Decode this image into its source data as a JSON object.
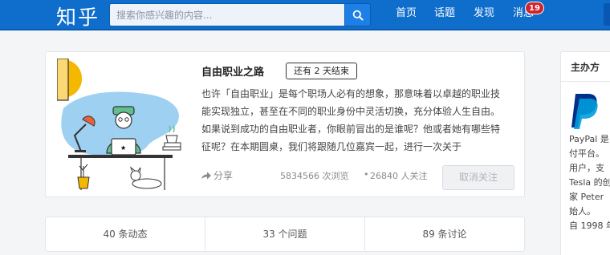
{
  "header": {
    "logo": "知乎",
    "search_placeholder": "搜索你感兴趣的内容...",
    "nav": {
      "home": "首页",
      "topics": "话题",
      "discover": "发现",
      "messages": "消息"
    },
    "message_count": "19"
  },
  "roundtable": {
    "title": "自由职业之路",
    "status": "还有 2 天结束",
    "description": "也许「自由职业」是每个职场人必有的想象，那意味着以卓越的职业技能实现独立，甚至在不同的职业身份中灵活切换，充分体验人生自由。如果说到成功的自由职业者，你眼前冒出的是谁呢？他或者她有哪些特征呢？在本期圆桌，我们将跟随几位嘉宾一起，进行一次关于",
    "share": "分享",
    "views": "5834566 次浏览",
    "separator": "•",
    "follows": "26840 人关注",
    "unfollow": "取消关注"
  },
  "tabs": [
    {
      "label": "40 条动态"
    },
    {
      "label": "33 个问题"
    },
    {
      "label": "89 条讨论"
    }
  ],
  "sidebar": {
    "title": "主办方",
    "lines": [
      "PayPal 是",
      "付平台。",
      "用户，支",
      "Tesla 的创",
      "家 Peter",
      "始人。",
      "自 1998 年"
    ]
  },
  "colors": {
    "topbar": "#0f6dcc",
    "badge": "#d0232b",
    "illustration_accent": "#f5b800",
    "illustration_blue": "#7ec0ec",
    "paypal_dark": "#003087",
    "paypal_light": "#009cde"
  },
  "icons": [
    "search-icon",
    "share-arrow-icon",
    "paypal-logo"
  ]
}
